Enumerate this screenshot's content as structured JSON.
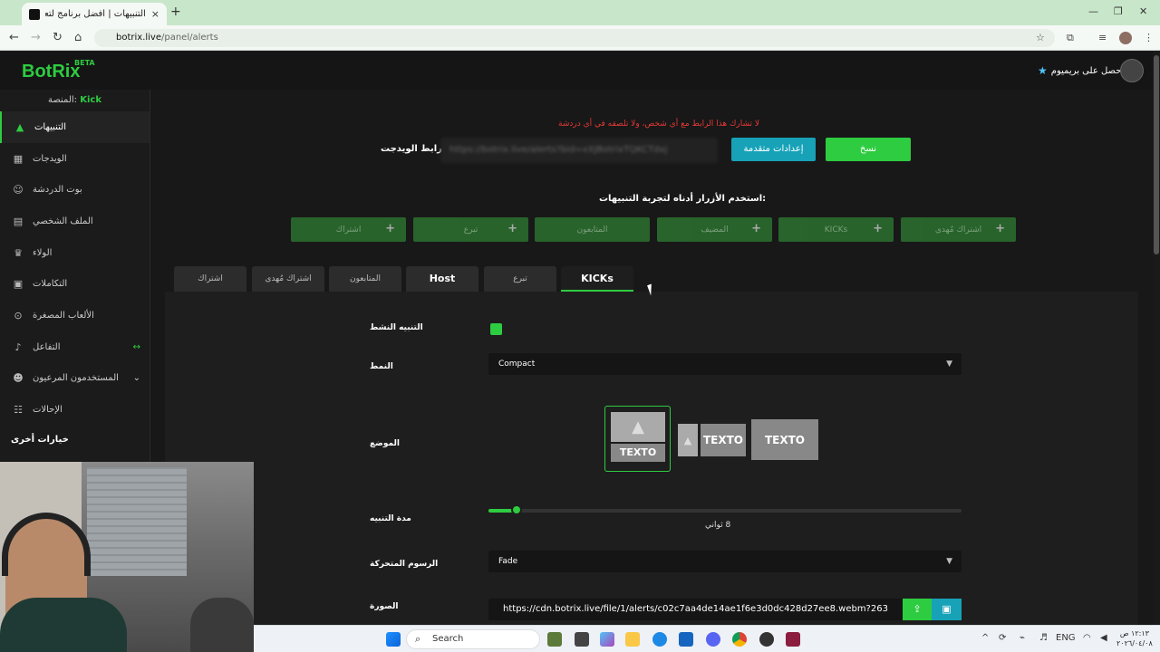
{
  "browser": {
    "tab_title": "التنبيهات | أفضل برنامج لتعزيز ال...",
    "url_host": "botrix.live",
    "url_path": "/panel/alerts",
    "new_tab": "+",
    "close_tab": "×"
  },
  "header": {
    "logo": "BotRix",
    "beta": "BETA",
    "premium_label": "احصل على بريميوم"
  },
  "sidebar": {
    "platform_label": "المنصة:",
    "platform_value": "Kick",
    "items": [
      {
        "label": "التنبيهات",
        "icon": "warning-icon"
      },
      {
        "label": "الويدجات",
        "icon": "widgets-icon"
      },
      {
        "label": "بوت الدردشة",
        "icon": "robot-icon"
      },
      {
        "label": "الملف الشخصي",
        "icon": "id-card-icon"
      },
      {
        "label": "الولاء",
        "icon": "trophy-icon"
      },
      {
        "label": "التكاملات",
        "icon": "plug-icon"
      },
      {
        "label": "الألعاب المصغرة",
        "icon": "gamepad-icon"
      },
      {
        "label": "التفاعل",
        "icon": "music-icon",
        "extra": "↔"
      },
      {
        "label": "المستخدمون المرعيون",
        "icon": "users-icon",
        "extra": "⌄"
      },
      {
        "label": "الإحالات",
        "icon": "referral-icon"
      }
    ],
    "other_options": "خيارات أخرى"
  },
  "alerts": {
    "warning": "لا تشارك هذا الرابط مع أي شخص، ولا تلصقه في أي دردشة",
    "widget_label": "رابط الويدجت:",
    "widget_url": "https://botrix.live/alerts?bid=xXJBotrixTQKCTdxj",
    "advanced_settings": "إعدادات متقدمة",
    "copy": "نسخ",
    "use_buttons_hint": "استخدم الأزرار أدناه لتجربة التنبيهات:",
    "test_buttons": [
      "اشتراك",
      "تبرع",
      "المتابعون",
      "المضيف",
      "KICKs",
      "اشتراك مُهدى"
    ],
    "tabs": [
      "اشتراك",
      "اشتراك مُهدى",
      "المتابعون",
      "Host",
      "تبرع",
      "KICKs"
    ],
    "active_tab_index": 5
  },
  "form": {
    "active_alert_label": "التنبيه النشط",
    "active_alert_checked": true,
    "style_label": "النمط",
    "style_value": "Compact",
    "position_label": "الموضع",
    "position_text": "TEXTO",
    "selected_position": 0,
    "duration_label": "مدة التنبيه",
    "duration_value": "8 ثواني",
    "duration_slider_fraction": 0.06,
    "animation_label": "الرسوم المتحركة",
    "animation_value": "Fade",
    "image_label": "الصورة",
    "image_url": "https://cdn.botrix.live/file/1/alerts/c02c7aa4de14ae1f6e3d0dc428d27ee8.webm?263"
  },
  "taskbar": {
    "search_placeholder": "Search",
    "language": "ENG",
    "time": "١٢:١٣ ص",
    "date": "٢٠٢٦/٠٤/٠٨"
  },
  "colors": {
    "accent": "#2ecc40",
    "info": "#17a2b8",
    "danger": "#e53935"
  }
}
